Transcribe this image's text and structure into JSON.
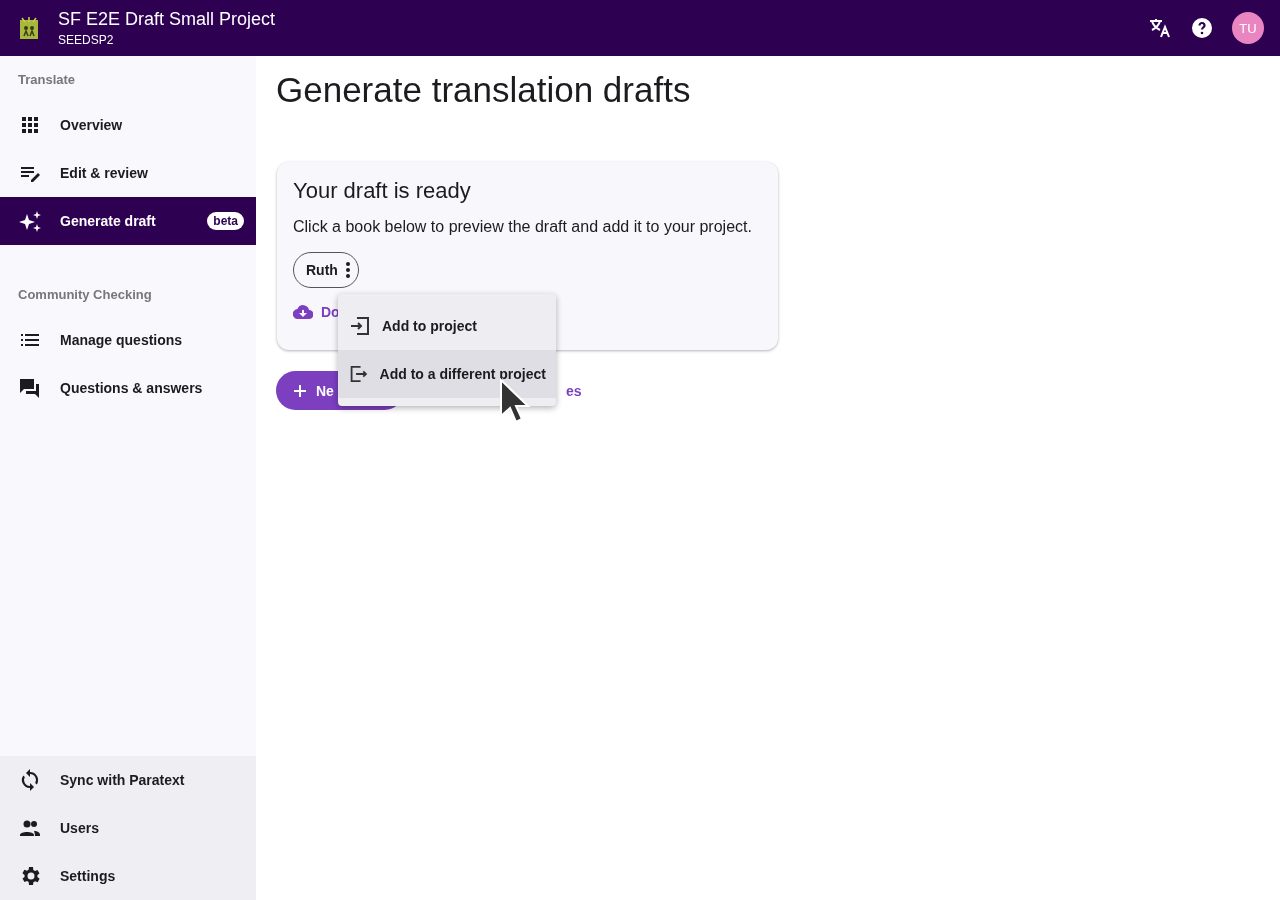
{
  "header": {
    "title": "SF E2E Draft Small Project",
    "subtitle": "SEEDSP2",
    "avatar": "TU"
  },
  "sidebar": {
    "sections": [
      {
        "heading": "Translate",
        "items": [
          {
            "label": "Overview",
            "kind": "grid",
            "selected": false
          },
          {
            "label": "Edit & review",
            "kind": "edit",
            "selected": false
          },
          {
            "label": "Generate draft",
            "kind": "sparkle",
            "selected": true,
            "badge": "beta"
          }
        ]
      },
      {
        "heading": "Community Checking",
        "items": [
          {
            "label": "Manage questions",
            "kind": "list",
            "selected": false
          },
          {
            "label": "Questions & answers",
            "kind": "chat",
            "selected": false
          }
        ]
      }
    ],
    "footer": [
      {
        "label": "Sync with Paratext",
        "kind": "sync"
      },
      {
        "label": "Users",
        "kind": "users"
      },
      {
        "label": "Settings",
        "kind": "gear"
      }
    ]
  },
  "page": {
    "title": "Generate translation drafts",
    "card": {
      "title": "Your draft is ready",
      "text": "Click a book below to preview the draft and add it to your project.",
      "books": [
        "Ruth"
      ],
      "download_link": "Do"
    },
    "new_button": "Ne",
    "link": "es"
  },
  "menu": {
    "items": [
      {
        "label": "Add to project",
        "kind": "enter",
        "selected": false
      },
      {
        "label": "Add to a different project",
        "kind": "exit",
        "selected": true
      }
    ]
  }
}
